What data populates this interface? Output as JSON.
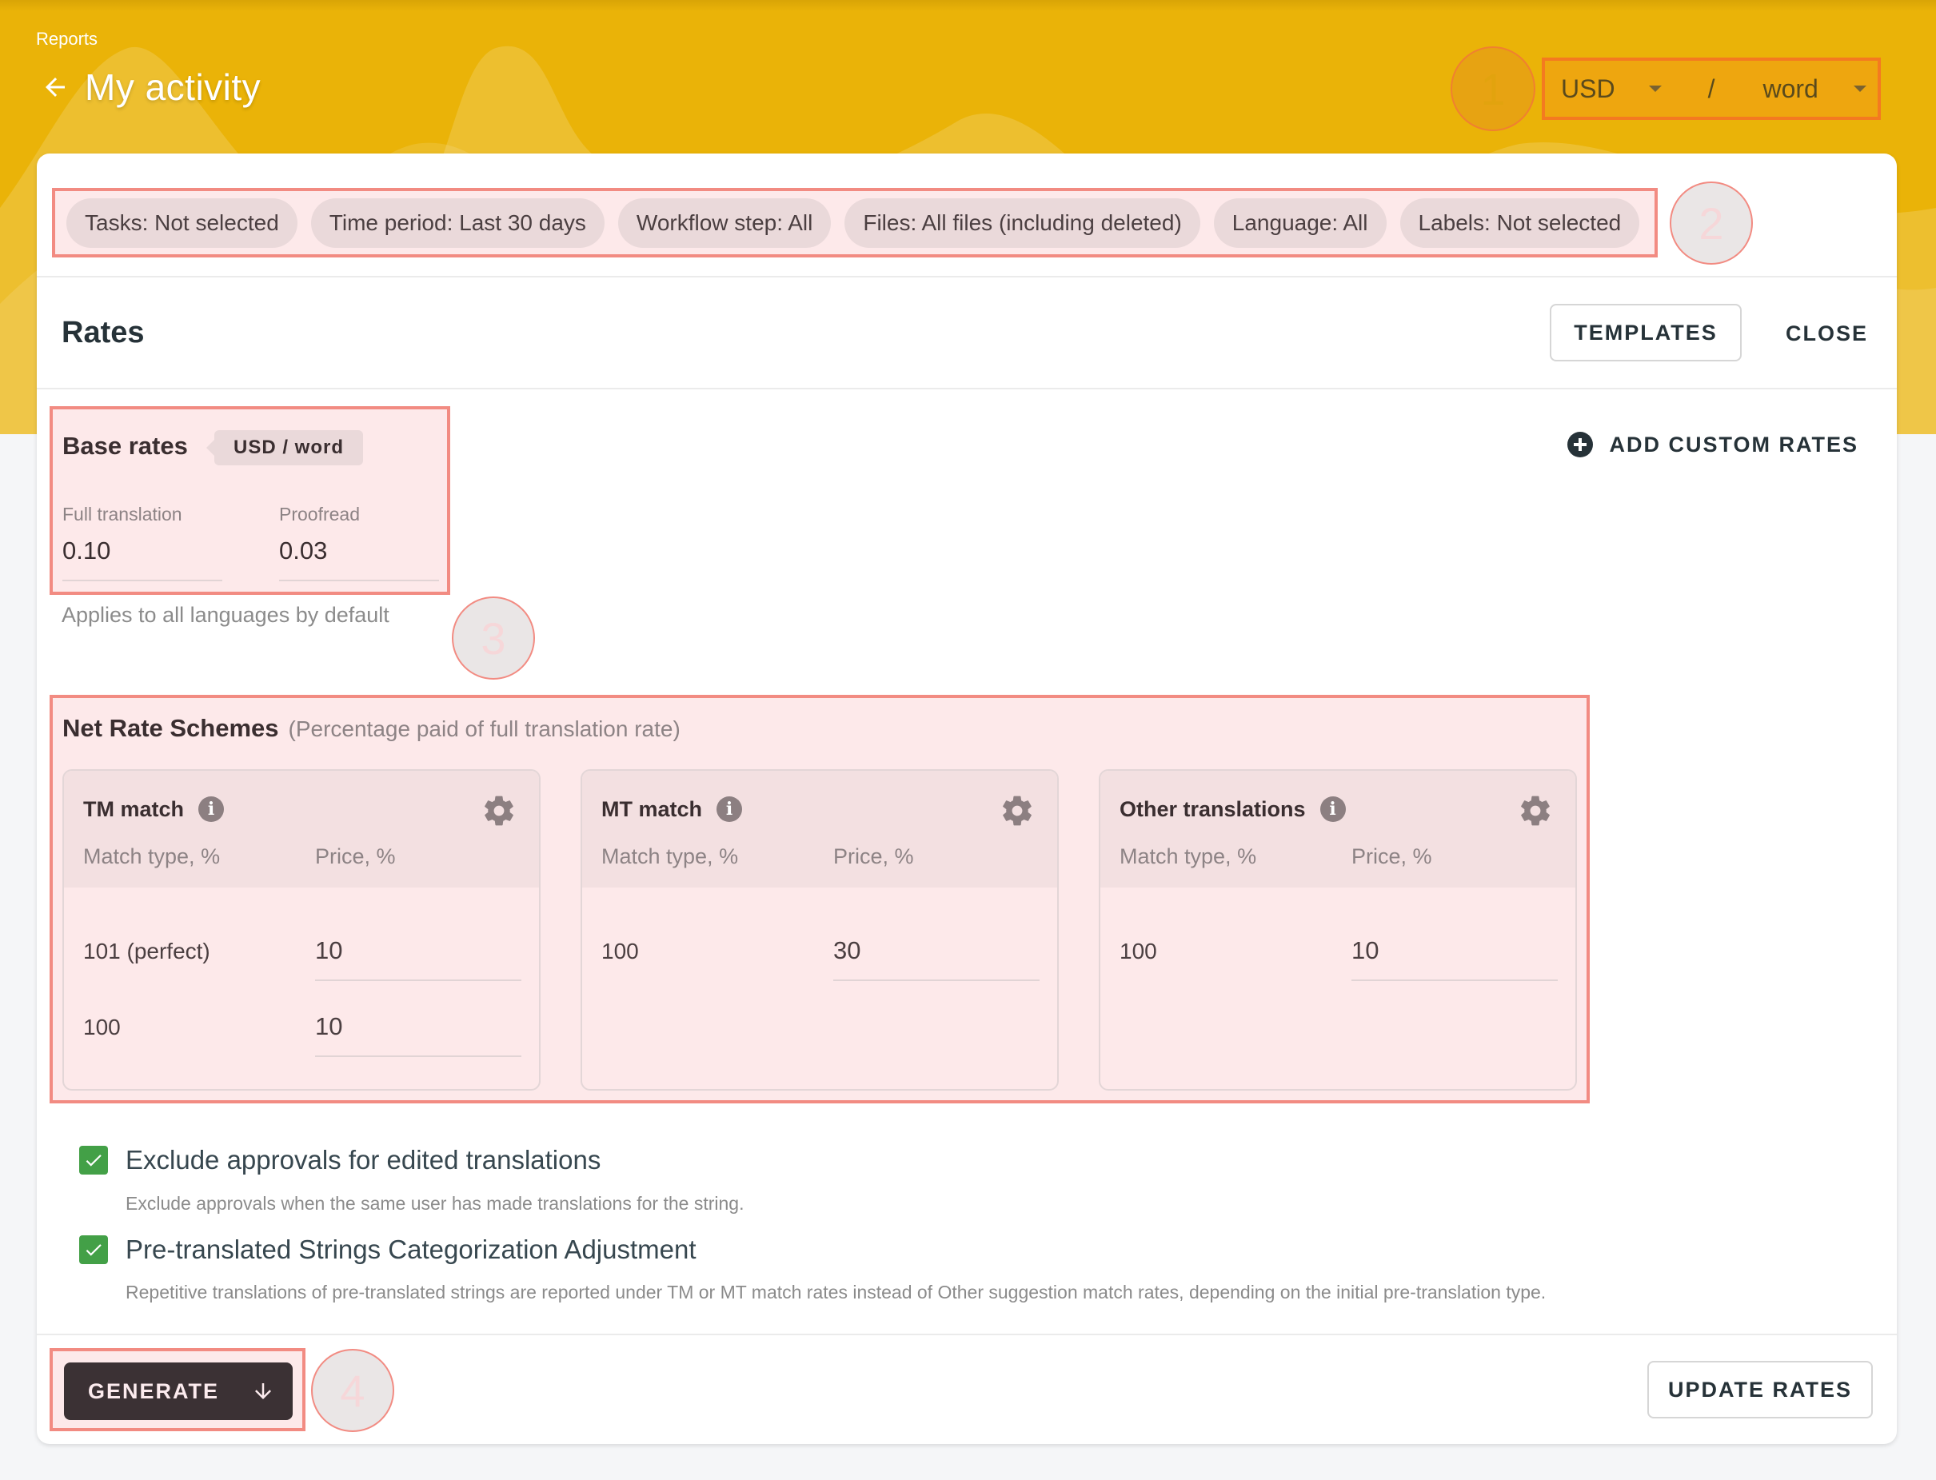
{
  "header": {
    "breadcrumb": "Reports",
    "title": "My activity",
    "currency": "USD",
    "separator": "/",
    "unit": "word"
  },
  "annotations": [
    "1",
    "2",
    "3",
    "4"
  ],
  "filters": [
    {
      "label": "Tasks: Not selected"
    },
    {
      "label": "Time period: Last 30 days"
    },
    {
      "label": "Workflow step: All"
    },
    {
      "label": "Files: All files (including deleted)"
    },
    {
      "label": "Language: All"
    },
    {
      "label": "Labels: Not selected"
    }
  ],
  "rates": {
    "title": "Rates",
    "templates_label": "TEMPLATES",
    "close_label": "CLOSE",
    "add_custom_label": "ADD CUSTOM RATES",
    "base": {
      "title": "Base rates",
      "unit_tag": "USD / word",
      "full_translation_label": "Full translation",
      "full_translation_value": "0.10",
      "proofread_label": "Proofread",
      "proofread_value": "0.03",
      "applies_text": "Applies to all languages by default"
    },
    "net": {
      "title": "Net Rate Schemes",
      "subtitle": "(Percentage paid of full translation rate)",
      "match_type_header": "Match type, %",
      "price_header": "Price, %",
      "schemes": [
        {
          "name": "TM match",
          "rows": [
            {
              "match": "101 (perfect)",
              "price": "10"
            },
            {
              "match": "100",
              "price": "10"
            }
          ]
        },
        {
          "name": "MT match",
          "rows": [
            {
              "match": "100",
              "price": "30"
            }
          ]
        },
        {
          "name": "Other translations",
          "rows": [
            {
              "match": "100",
              "price": "10"
            }
          ]
        }
      ]
    },
    "options": [
      {
        "title": "Exclude approvals for edited translations",
        "description": "Exclude approvals when the same user has made translations for the string.",
        "checked": true
      },
      {
        "title": "Pre-translated Strings Categorization Adjustment",
        "description": "Repetitive translations of pre-translated strings are reported under TM or MT match rates instead of Other suggestion match rates, depending on the initial pre-translation type.",
        "checked": true
      }
    ],
    "generate_label": "GENERATE",
    "update_label": "UPDATE RATES"
  },
  "colors": {
    "brand_yellow": "#eab308",
    "annotation_red": "#f28b82",
    "checkbox_green": "#43a047",
    "primary_dark": "#3b3134"
  }
}
